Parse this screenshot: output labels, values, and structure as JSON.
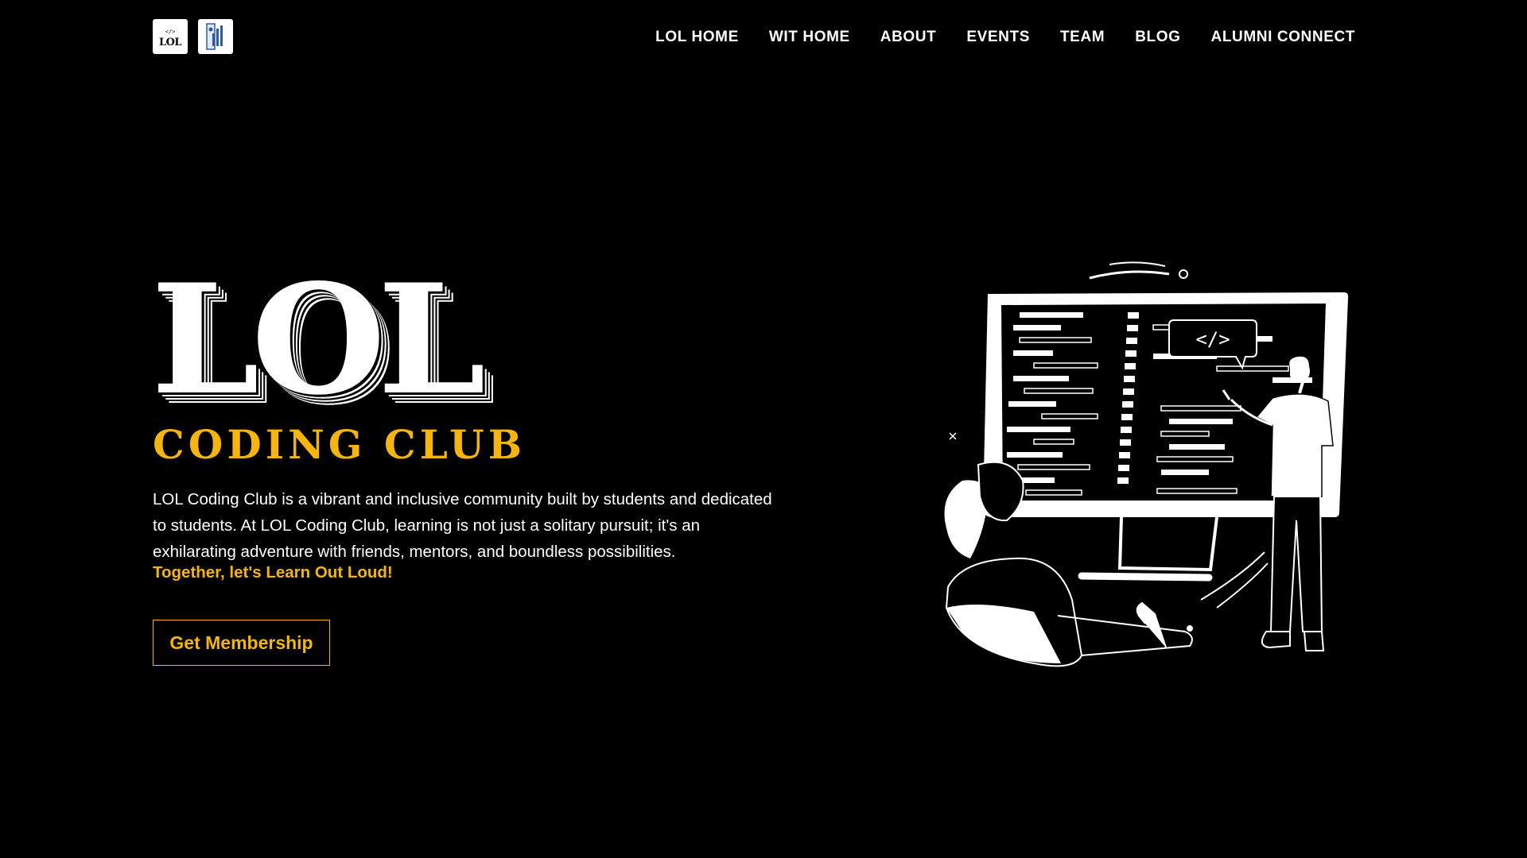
{
  "header": {
    "logos": [
      {
        "name": "lol-logo",
        "text": "LOL"
      },
      {
        "name": "wit-logo"
      }
    ],
    "nav": [
      {
        "label": "LOL HOME"
      },
      {
        "label": "WIT HOME"
      },
      {
        "label": "ABOUT"
      },
      {
        "label": "EVENTS"
      },
      {
        "label": "TEAM"
      },
      {
        "label": "BLOG"
      },
      {
        "label": "ALUMNI CONNECT"
      }
    ]
  },
  "hero": {
    "title": "LOL",
    "subtitle": "CODING CLUB",
    "description": "LOL Coding Club is a vibrant and inclusive community built by students and dedicated to students. At LOL Coding Club, learning is not just a solitary pursuit; it's an exhilarating adventure with friends, mentors, and boundless possibilities.",
    "tagline": "Together, let's Learn Out Loud!",
    "cta_label": "Get Membership"
  },
  "illustration": {
    "code_tag": "</>"
  },
  "colors": {
    "background": "#000000",
    "text": "#ffffff",
    "accent": "#f5b50e"
  },
  "icons": [
    "lol-logo",
    "wit-logo",
    "code-tag-icon"
  ]
}
